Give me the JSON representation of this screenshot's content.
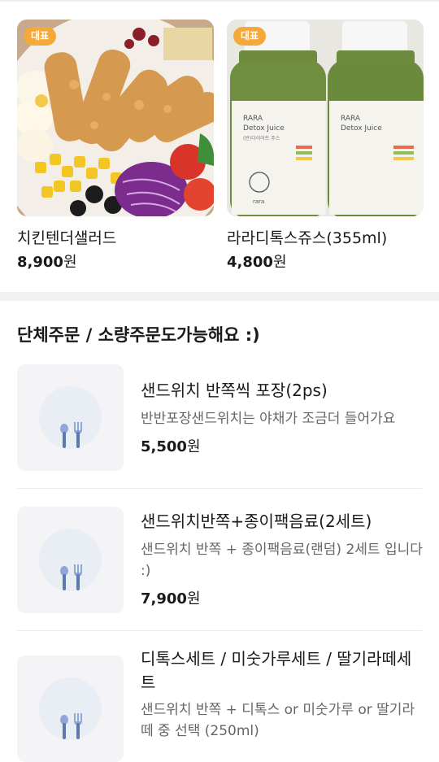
{
  "featured": [
    {
      "badge": "대표",
      "name": "치킨텐더샐러드",
      "price": "8,900",
      "won": "원"
    },
    {
      "badge": "대표",
      "name": "라라디톡스쥬스(355ml)",
      "price": "4,800",
      "won": "원"
    }
  ],
  "section_title": "단체주문 / 소량주문도가능해요 :)",
  "items": [
    {
      "name": "샌드위치 반쪽씩 포장(2ps)",
      "desc": "반반포장샌드위치는 야채가 조금더 들어가요",
      "price": "5,500",
      "won": "원"
    },
    {
      "name": "샌드위치반쪽+종이팩음료(2세트)",
      "desc": "샌드위치 반쪽 + 종이팩음료(랜덤) 2세트 입니다 :)",
      "price": "7,900",
      "won": "원"
    },
    {
      "name": "디톡스세트 / 미숫가루세트 / 딸기라떼세트",
      "desc": "샌드위치 반쪽 + 디톡스 or 미숫가루 or 딸기라떼 중 선택 (250ml)",
      "price": "",
      "won": ""
    }
  ],
  "bottle_label": {
    "brand": "RARA",
    "product": "Detox Juice",
    "korean": "(반)다이어트 주스",
    "logo": "rara"
  },
  "colors": {
    "badge": "#f6a93b",
    "placeholder_bg": "#f4f4f6",
    "icon": "#8fa6d6"
  }
}
